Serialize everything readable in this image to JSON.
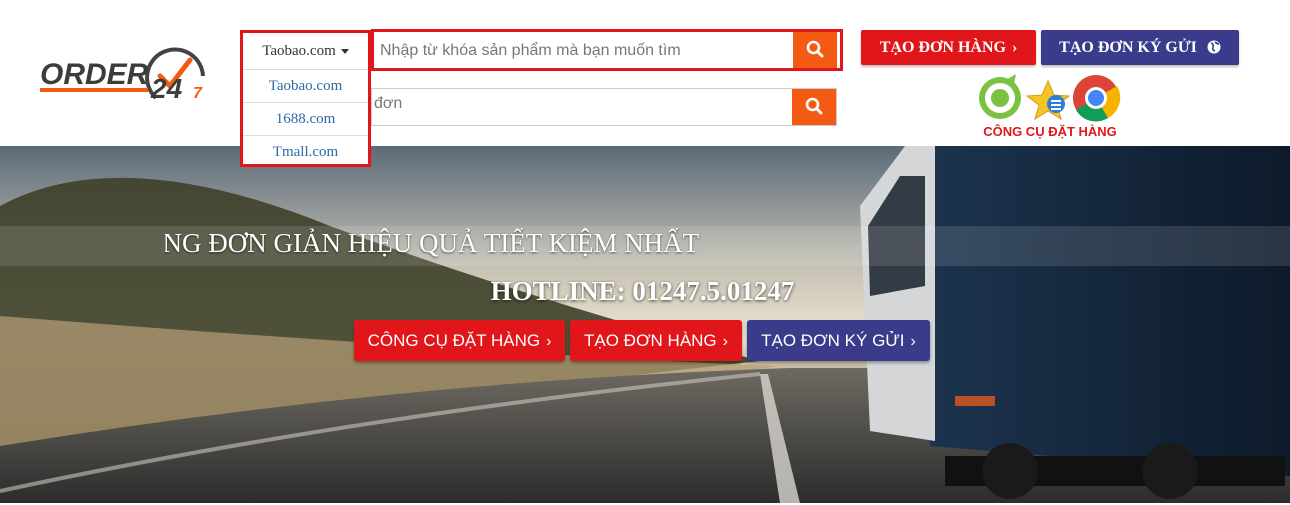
{
  "brand": {
    "logo_text": "ORDER",
    "logo_number": "24",
    "logo_small": "7"
  },
  "search": {
    "store_selected": "Taobao.com",
    "store_options": [
      "Taobao.com",
      "1688.com",
      "Tmall.com"
    ],
    "placeholder": "Nhập từ khóa sản phẩm mà bạn muốn tìm",
    "second_placeholder_fragment": "đơn"
  },
  "header": {
    "create_order_label": "TẠO ĐƠN HÀNG",
    "create_consign_label": "TẠO ĐƠN KÝ GỬI",
    "tool_label": "CÔNG CỤ ĐẶT HÀNG"
  },
  "hero": {
    "slogan": "ÀNG ĐƠN GIẢN HIỆU QUẢ TIẾT KIỆM NHẤT",
    "hotline": "HOTLINE: 01247.5.01247",
    "buttons": {
      "tool": "CÔNG CỤ ĐẶT HÀNG",
      "order": "TẠO ĐƠN HÀNG",
      "consign": "TẠO ĐƠN KÝ GỬI"
    }
  },
  "colors": {
    "red": "#e0161b",
    "navy": "#3a3c8b",
    "orange": "#f45a12",
    "link": "#2c6aa8"
  },
  "icons": [
    "search-icon",
    "chevron-right-icon",
    "globe-icon",
    "coccoc-icon",
    "ie-icon",
    "chrome-icon",
    "caret-down-icon"
  ]
}
